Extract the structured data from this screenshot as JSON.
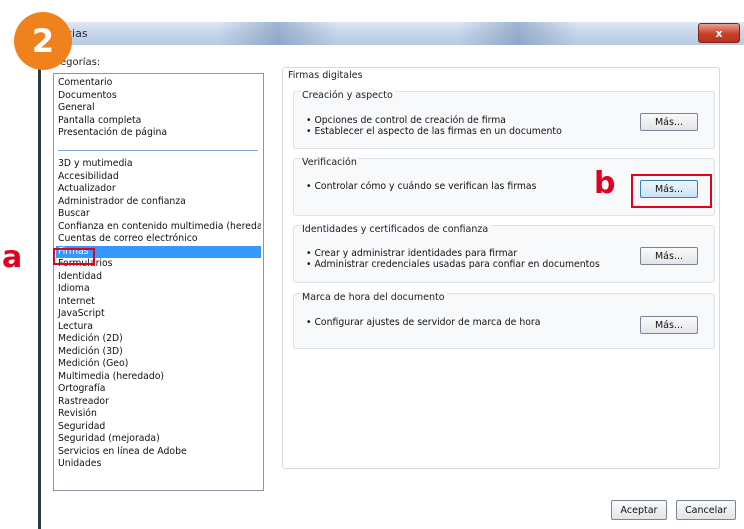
{
  "window": {
    "title": "Preferencias",
    "title_visible": "cias",
    "close_label": "x"
  },
  "badge": {
    "step": "2"
  },
  "annotations": {
    "a": "a",
    "b": "b"
  },
  "sidebar": {
    "label": "Categorías:",
    "label_visible": "egorías:",
    "group1": [
      "Comentario",
      "Documentos",
      "General",
      "Pantalla completa",
      "Presentación de página"
    ],
    "group2": [
      "3D y mutimedia",
      "Accesibilidad",
      "Actualizador",
      "Administrador de confianza",
      "Buscar",
      "Confianza en contenido multimedia (heredado)",
      "Cuentas de correo electrónico",
      "Firmas",
      "Formularios",
      "Identidad",
      "Idioma",
      "Internet",
      "JavaScript",
      "Lectura",
      "Medición (2D)",
      "Medición (3D)",
      "Medición (Geo)",
      "Multimedia (heredado)",
      "Ortografía",
      "Rastreador",
      "Revisión",
      "Seguridad",
      "Seguridad (mejorada)",
      "Servicios en línea de Adobe",
      "Unidades"
    ],
    "selected": "Firmas"
  },
  "main": {
    "heading": "Firmas digitales",
    "groups": [
      {
        "title": "Creación y aspecto",
        "lines": [
          "• Opciones de control de creación de firma",
          "• Establecer el aspecto de las firmas en un documento"
        ],
        "button": "Más..."
      },
      {
        "title": "Verificación",
        "lines": [
          "• Controlar cómo y cuándo se verifican las firmas"
        ],
        "button": "Más..."
      },
      {
        "title": "Identidades y certificados de confianza",
        "lines": [
          "• Crear y administrar identidades para firmar",
          "• Administrar credenciales usadas para confiar en documentos"
        ],
        "button": "Más..."
      },
      {
        "title": "Marca de hora del documento",
        "lines": [
          "• Configurar ajustes de servidor de marca de hora"
        ],
        "button": "Más..."
      }
    ]
  },
  "footer": {
    "accept_label": "Aceptar",
    "cancel_label": "Cancelar"
  },
  "colors": {
    "selection": "#3399ff",
    "annotation_red": "#e1001f",
    "badge_orange": "#f0821e"
  }
}
